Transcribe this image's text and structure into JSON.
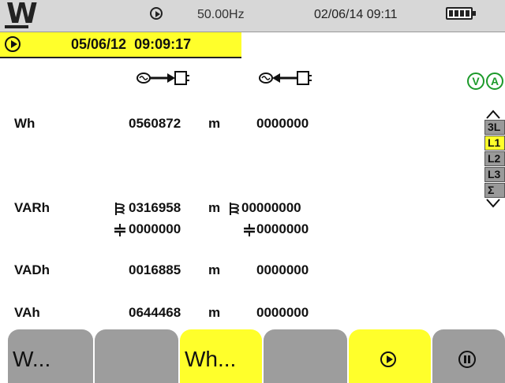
{
  "status_bar": {
    "logo": "W",
    "frequency": "50.00Hz",
    "datetime": "02/06/14 09:11",
    "battery_level": 1.0
  },
  "recording": {
    "start_timestamp": "05/06/12  09:09:17"
  },
  "icons": {
    "consumed": "energy-consumed-icon",
    "generated": "energy-generated-icon",
    "voltage": "V",
    "current": "A"
  },
  "rows": {
    "wh": {
      "label": "Wh",
      "consumed": "0560872",
      "unit": "m",
      "generated": "0000000"
    },
    "varh": {
      "label": "VARh",
      "inductive_consumed": "0316958",
      "unit": "m",
      "inductive_generated": "00000000",
      "capacitive_consumed": "0000000",
      "capacitive_generated": "0000000"
    },
    "vadh": {
      "label": "VADh",
      "consumed": "0016885",
      "unit": "m",
      "generated": "0000000"
    },
    "vah": {
      "label": "VAh",
      "consumed": "0644468",
      "unit": "m",
      "generated": "0000000"
    }
  },
  "phase_selector": {
    "items": [
      "3L",
      "L1",
      "L2",
      "L3",
      "Σ"
    ],
    "selected": "L1"
  },
  "tabs": {
    "w": "W...",
    "wh": "Wh...",
    "selected": "Wh..."
  },
  "colors": {
    "accent_yellow": "#ffff2b",
    "tab_gray": "#9d9d9d",
    "status_gray": "#d7d7d7",
    "vi_green": "#1c9a2a"
  }
}
